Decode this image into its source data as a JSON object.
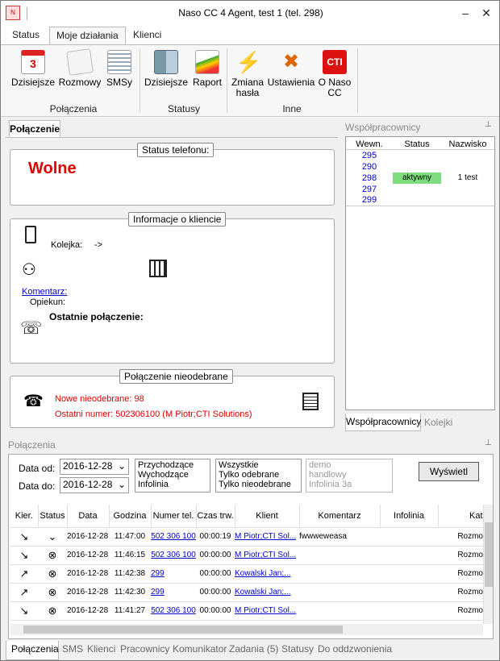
{
  "window": {
    "title": "Naso CC 4 Agent, test 1 (tel. 298)",
    "min": "–",
    "close": "✕"
  },
  "tabs": [
    "Status",
    "Moje działania",
    "Klienci"
  ],
  "ribbon": {
    "groups": [
      {
        "label": "Połączenia"
      },
      {
        "label": "Statusy"
      },
      {
        "label": "Inne"
      }
    ],
    "buttons": [
      "Dzisiejsze",
      "Rozmowy",
      "SMSy",
      "Dzisiejsze",
      "Raport",
      "Zmiana hasła",
      "Ustawienia",
      "O Naso CC"
    ],
    "calendar_day": "3",
    "cti_logo": "CTI"
  },
  "left": {
    "tab": "Połączenie",
    "phone_status": {
      "legend": "Status telefonu:",
      "value": "Wolne"
    },
    "client_info": {
      "legend": "Informacje o kliencie",
      "queue_label": "Kolejka:",
      "queue_value": "->",
      "comment": "Komentarz:",
      "guardian": "Opiekun:",
      "last_call": "Ostatnie połączenie:"
    },
    "missed": {
      "legend": "Połączenie nieodebrane",
      "new": "Nowe nieodebrane: 98",
      "last": "Ostatni numer: 502306100 (M Piotr;CTI Solutions)"
    }
  },
  "coworkers": {
    "title": "Współpracownicy",
    "pin": "⊥",
    "headers": [
      "Wewn.",
      "Status",
      "Nazwisko"
    ],
    "rows": [
      {
        "ext": "295",
        "status": "",
        "name": ""
      },
      {
        "ext": "290",
        "status": "",
        "name": ""
      },
      {
        "ext": "298",
        "status": "aktywny",
        "name": "1 test"
      },
      {
        "ext": "297",
        "status": "",
        "name": ""
      },
      {
        "ext": "299",
        "status": "",
        "name": ""
      }
    ],
    "tabs": [
      "Współpracownicy",
      "Kolejki"
    ]
  },
  "calls": {
    "title": "Połączenia",
    "date_from_label": "Data od:",
    "date_from": "2016-12-28",
    "date_to_label": "Data do:",
    "date_to": "2016-12-28",
    "directions": [
      "Przychodzące",
      "Wychodzące",
      "Infolinia"
    ],
    "scopes": [
      "Wszystkie",
      "Tylko odebrane",
      "Tylko nieodebrane"
    ],
    "lines": [
      "demo",
      "handlowy",
      "Infolinia 3a"
    ],
    "show_button": "Wyświetl",
    "headers": [
      "Kier.",
      "Status",
      "Data",
      "Godzina",
      "Numer tel.",
      "Czas trw.",
      "Klient",
      "Komentarz",
      "Infolinia",
      "Kat"
    ],
    "rows": [
      {
        "dir": "↘",
        "status": "⌄",
        "date": "2016-12-28",
        "time": "11:47:00",
        "number": "502 306 100",
        "dur": "00:00:19",
        "client": "M Piotr;CTI Sol...",
        "comment": "fwwweweasa",
        "line": "",
        "cat": "Rozmo"
      },
      {
        "dir": "↘",
        "status": "⊗",
        "date": "2016-12-28",
        "time": "11:46:15",
        "number": "502 306 100",
        "dur": "00:00:00",
        "client": "M Piotr;CTI Sol...",
        "comment": "",
        "line": "",
        "cat": "Rozmo"
      },
      {
        "dir": "↗",
        "status": "⊗",
        "date": "2016-12-28",
        "time": "11:42:38",
        "number": "299",
        "dur": "00:00:00",
        "client": "Kowalski Jan;...",
        "comment": "",
        "line": "",
        "cat": "Rozmo"
      },
      {
        "dir": "↗",
        "status": "⊗",
        "date": "2016-12-28",
        "time": "11:42:30",
        "number": "299",
        "dur": "00:00:00",
        "client": "Kowalski Jan;...",
        "comment": "",
        "line": "",
        "cat": "Rozmo"
      },
      {
        "dir": "↘",
        "status": "⊗",
        "date": "2016-12-28",
        "time": "11:41:27",
        "number": "502 306 100",
        "dur": "00:00:00",
        "client": "M Piotr;CTI Sol...",
        "comment": "",
        "line": "",
        "cat": "Rozmo"
      }
    ]
  },
  "bottom_tabs": [
    "Połączenia",
    "SMS",
    "Klienci",
    "Pracownicy",
    "Komunikator",
    "Zadania (5)",
    "Statusy",
    "Do oddzwonienia"
  ]
}
